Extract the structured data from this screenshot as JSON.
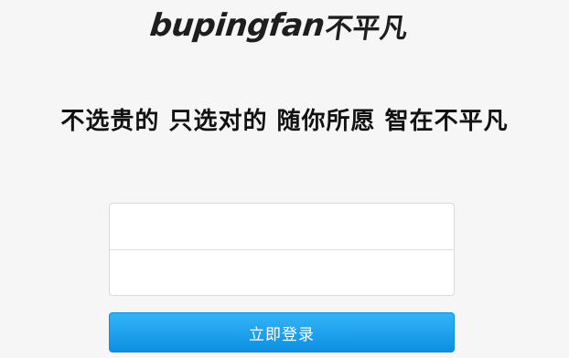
{
  "logo": {
    "latin_text": "bupingfan",
    "chinese_text": "不平凡"
  },
  "slogan": "不选贵的 只选对的 随你所愿 智在不平凡",
  "form": {
    "username": {
      "value": "",
      "placeholder": ""
    },
    "password": {
      "value": "",
      "placeholder": ""
    }
  },
  "login_button": {
    "label": "立即登录"
  },
  "colors": {
    "background": "#f6f6f6",
    "button_top": "#34b4f7",
    "button_bottom": "#0d8fe2",
    "text": "#111111"
  }
}
